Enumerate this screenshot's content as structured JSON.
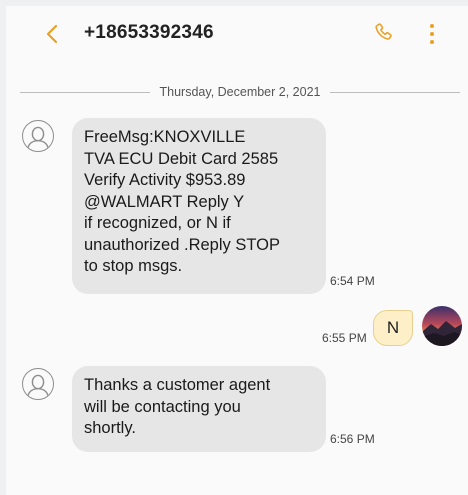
{
  "header": {
    "title": "+18653392346"
  },
  "conversation": {
    "date_divider": "Thursday, December 2, 2021",
    "messages": [
      {
        "direction": "incoming",
        "text": "FreeMsg:KNOXVILLE\nTVA ECU Debit Card 2585\nVerify Activity $953.89\n@WALMART Reply Y\nif recognized, or N if\nunauthorized .Reply STOP\nto stop msgs.",
        "time": "6:54 PM"
      },
      {
        "direction": "outgoing",
        "text": "N",
        "time": "6:55 PM"
      },
      {
        "direction": "incoming",
        "text": "Thanks a customer agent\nwill be contacting you\nshortly.",
        "time": "6:56 PM"
      }
    ]
  },
  "colors": {
    "accent": "#e8a126",
    "incoming_bubble": "#e6e6e6",
    "outgoing_bubble": "#fdf0c8"
  },
  "icons": [
    "back-arrow-icon",
    "phone-icon",
    "more-options-icon",
    "contact-avatar-icon"
  ]
}
